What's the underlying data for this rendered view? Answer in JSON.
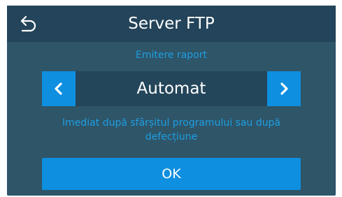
{
  "header": {
    "title": "Server FTP",
    "back_icon": "back-arrow-icon"
  },
  "setting": {
    "label": "Emitere raport",
    "value": "Automat",
    "prev_icon": "chevron-left-icon",
    "next_icon": "chevron-right-icon",
    "description": "Imediat după sfârșitul programului sau după defecțiune"
  },
  "actions": {
    "ok_label": "OK"
  },
  "colors": {
    "screen_bg": "#2e5568",
    "header_bg": "#23445a",
    "accent": "#0e8fe0",
    "label_text": "#1e9fe3",
    "text": "#ffffff"
  }
}
